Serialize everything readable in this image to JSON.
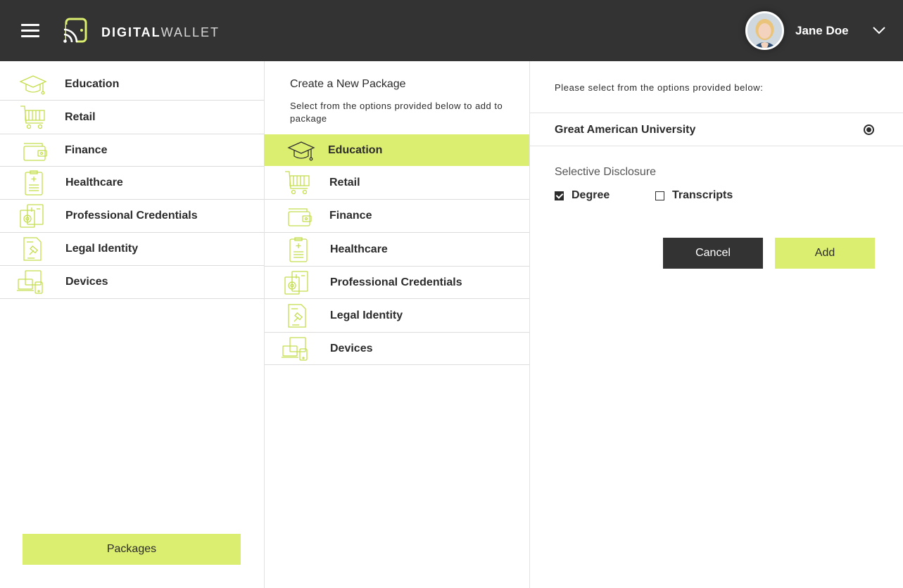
{
  "header": {
    "brand_bold": "DIGITAL",
    "brand_light": "WALLET",
    "user_name": "Jane Doe"
  },
  "sidebar": {
    "items": [
      {
        "label": "Education",
        "icon": "graduation-cap-icon"
      },
      {
        "label": "Retail",
        "icon": "shopping-cart-icon"
      },
      {
        "label": "Finance",
        "icon": "wallet-icon"
      },
      {
        "label": "Healthcare",
        "icon": "clipboard-icon"
      },
      {
        "label": "Professional Credentials",
        "icon": "credential-icon"
      },
      {
        "label": "Legal Identity",
        "icon": "legal-document-icon"
      },
      {
        "label": "Devices",
        "icon": "devices-icon"
      }
    ],
    "packages_label": "Packages"
  },
  "package": {
    "title": "Create a New Package",
    "subtitle": "Select from the options provided below to add to package",
    "items": [
      {
        "label": "Education",
        "icon": "graduation-cap-icon",
        "selected": true
      },
      {
        "label": "Retail",
        "icon": "shopping-cart-icon"
      },
      {
        "label": "Finance",
        "icon": "wallet-icon"
      },
      {
        "label": "Healthcare",
        "icon": "clipboard-icon"
      },
      {
        "label": "Professional Credentials",
        "icon": "credential-icon"
      },
      {
        "label": "Legal Identity",
        "icon": "legal-document-icon"
      },
      {
        "label": "Devices",
        "icon": "devices-icon"
      }
    ]
  },
  "detail": {
    "prompt": "Please select from the options provided below:",
    "university": "Great American University",
    "university_selected": true,
    "selective_disclosure_label": "Selective Disclosure",
    "options": [
      {
        "label": "Degree",
        "checked": true
      },
      {
        "label": "Transcripts",
        "checked": false
      }
    ],
    "cancel_label": "Cancel",
    "add_label": "Add"
  },
  "colors": {
    "accent": "#dcee70",
    "header_bg": "#333333",
    "icon_stroke": "#c4de4e"
  }
}
